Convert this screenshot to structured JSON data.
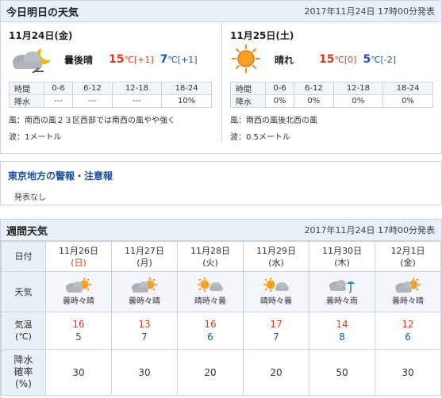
{
  "today_tomorrow": {
    "title": "今日明日の天気",
    "issued": "2017年11月24日 17時00分発表",
    "days": [
      {
        "date": "11月24日(金)",
        "weather_icon": "cloudy-then-clear-night-icon",
        "telop": "曇後晴",
        "high": "15",
        "high_unit": "℃",
        "high_diff": "[+1]",
        "low": "7",
        "low_unit": "℃",
        "low_diff": "[+1]",
        "rain_table": {
          "time_label": "時間",
          "rain_label": "降水",
          "periods": [
            "0-6",
            "6-12",
            "12-18",
            "18-24"
          ],
          "values": [
            "---",
            "---",
            "---",
            "10%"
          ]
        },
        "wind": "風：南西の風２３区西部では南西の風やや強く",
        "wave": "波：1メートル"
      },
      {
        "date": "11月25日(土)",
        "weather_icon": "sunny-icon",
        "telop": "晴れ",
        "high": "15",
        "high_unit": "℃",
        "high_diff": "[0]",
        "low": "5",
        "low_unit": "℃",
        "low_diff": "[-2]",
        "rain_table": {
          "time_label": "時間",
          "rain_label": "降水",
          "periods": [
            "0-6",
            "6-12",
            "12-18",
            "18-24"
          ],
          "values": [
            "0%",
            "0%",
            "0%",
            "0%"
          ]
        },
        "wind": "風：南西の風後北西の風",
        "wave": "波：0.5メートル"
      }
    ]
  },
  "warnings": {
    "title": "東京地方の警報・注意報",
    "text": "発表なし"
  },
  "weekly": {
    "title": "週間天気",
    "issued": "2017年11月24日 17時00分発表",
    "row_labels": {
      "date": "日付",
      "weather": "天気",
      "temp_line1": "気温",
      "temp_line2": "(℃)",
      "pop_line1": "降水",
      "pop_line2": "確率",
      "pop_line3": "(%)"
    },
    "days": [
      {
        "date": "11月26日",
        "dow": "(日)",
        "dow_type": "sun",
        "icon": "cloudy-sometimes-sunny-icon",
        "weather": "曇時々晴",
        "high": "16",
        "low": "5",
        "pop": "30"
      },
      {
        "date": "11月27日",
        "dow": "(月)",
        "dow_type": "weekday",
        "icon": "cloudy-sometimes-sunny-icon",
        "weather": "曇時々晴",
        "high": "13",
        "low": "7",
        "pop": "30"
      },
      {
        "date": "11月28日",
        "dow": "(火)",
        "dow_type": "weekday",
        "icon": "sunny-sometimes-cloudy-icon",
        "weather": "晴時々曇",
        "high": "16",
        "low": "6",
        "pop": "20"
      },
      {
        "date": "11月29日",
        "dow": "(水)",
        "dow_type": "weekday",
        "icon": "sunny-sometimes-cloudy-icon",
        "weather": "晴時々曇",
        "high": "17",
        "low": "7",
        "pop": "20"
      },
      {
        "date": "11月30日",
        "dow": "(木)",
        "dow_type": "weekday",
        "icon": "cloudy-sometimes-rain-icon",
        "weather": "曇時々雨",
        "high": "14",
        "low": "8",
        "pop": "50"
      },
      {
        "date": "12月1日",
        "dow": "(金)",
        "dow_type": "weekday",
        "icon": "cloudy-sometimes-sunny-icon",
        "weather": "曇時々晴",
        "high": "12",
        "low": "6",
        "pop": "30"
      }
    ]
  },
  "colors": {
    "high_temp": "#e03a1e",
    "low_temp": "#1c56b8",
    "header_bg": "#eaf0f7",
    "border": "#c9d3e3",
    "link_blue": "#1a4fa1"
  }
}
